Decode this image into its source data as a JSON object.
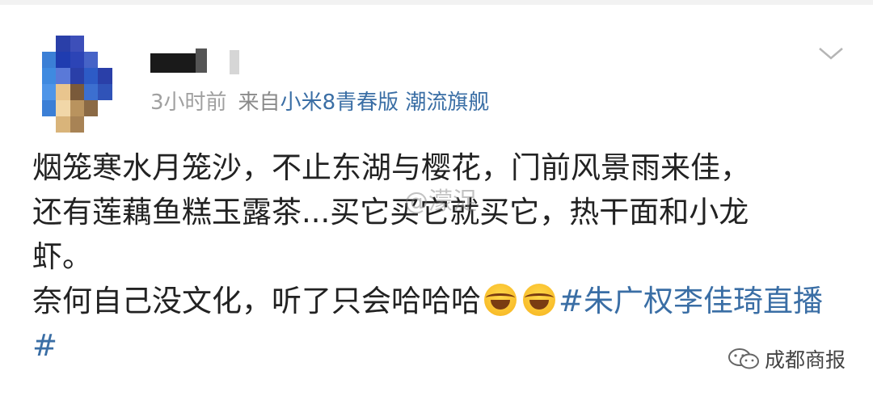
{
  "post": {
    "meta_time": "3小时前",
    "meta_from": "来自",
    "meta_device": "小米8青春版 潮流旗舰",
    "line1": "烟笼寒水月笼沙，不止东湖与樱花，门前风景雨来佳，",
    "line2": "还有莲藕鱼糕玉露茶...买它买它就买它，热干面和小龙",
    "line3": "虾。",
    "line4_text": "奈何自己没文化，听了只会哈哈哈",
    "hashtag": "#朱广权李佳琦直播#"
  },
  "icons": {
    "avatar": "avatar-blurred",
    "more": "chevron-down-icon",
    "emoji": "laugh-cry-emoji",
    "wechat": "wechat-icon"
  },
  "watermarks": {
    "weibo": "@濛浞",
    "source": "成都商报"
  },
  "colors": {
    "link": "#3a6ea5",
    "text": "#222222",
    "meta": "#a0a0a0"
  }
}
